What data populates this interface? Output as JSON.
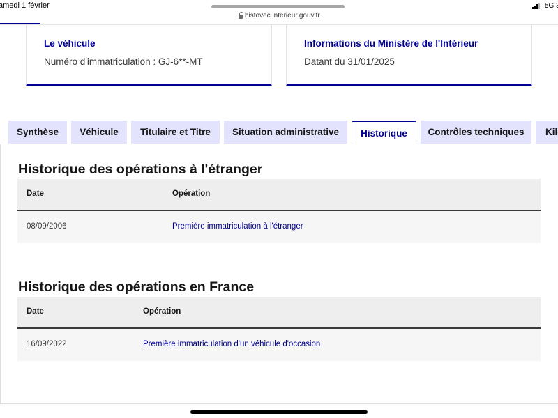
{
  "status_bar": {
    "time": "amedi 1 février",
    "url": "histovec.interieur.gouv.fr",
    "network": "5G 3"
  },
  "cards": [
    {
      "title": "Le véhicule",
      "text": "Numéro d'immatriculation : GJ-6**-MT"
    },
    {
      "title": "Informations du Ministère de l'Intérieur",
      "text": "Datant du 31/01/2025"
    }
  ],
  "tabs": [
    {
      "label": "Synthèse",
      "active": false
    },
    {
      "label": "Véhicule",
      "active": false
    },
    {
      "label": "Titulaire et Titre",
      "active": false
    },
    {
      "label": "Situation administrative",
      "active": false
    },
    {
      "label": "Historique",
      "active": true
    },
    {
      "label": "Contrôles techniques",
      "active": false
    },
    {
      "label": "Kilo",
      "active": false
    }
  ],
  "sections": [
    {
      "title": "Historique des opérations à l'étranger",
      "columns": [
        "Date",
        "Opération"
      ],
      "rows": [
        {
          "date": "08/09/2006",
          "operation": "Première immatriculation à l'étranger"
        }
      ]
    },
    {
      "title": "Historique des opérations en France",
      "columns": [
        "Date",
        "Opération"
      ],
      "rows": [
        {
          "date": "16/09/2022",
          "operation": "Première immatriculation d'un véhicule d'occasion"
        }
      ]
    }
  ],
  "colors": {
    "accent": "#000091",
    "tab_background": "#e3e3fd",
    "table_header": "#eeeeee",
    "table_row": "#f6f6f6"
  }
}
